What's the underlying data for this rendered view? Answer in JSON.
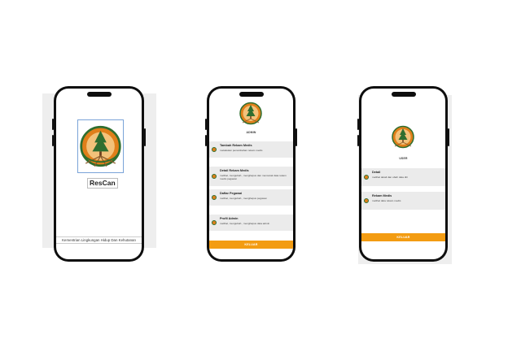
{
  "screens": {
    "splash": {
      "app_name": "ResCan",
      "footer": "Kementrian Lingkungan Hidup Dan Kehutanan",
      "logo_icon": "klhk-logo-icon"
    },
    "admin": {
      "role_title": "ADMIN",
      "menu": [
        {
          "title": "Tambah Rekam Medis",
          "desc": "melakukan penambahan rekam medis",
          "icon": "klhk-logo-icon"
        },
        {
          "title": "Detail Rekam Medis",
          "desc": "melihat, mengubah , menghapus dan mencetak data rekam medis pegawai",
          "icon": "klhk-logo-icon"
        },
        {
          "title": "Daftar Pegawai",
          "desc": "melihat, mengubah , menghapus pegawai",
          "icon": "klhk-logo-icon"
        },
        {
          "title": "Profil Admin",
          "desc": "melihat, mengubah , menghapus data admin",
          "icon": "klhk-logo-icon"
        }
      ],
      "logout_label": "KELUAR"
    },
    "user": {
      "role_title": "USER",
      "menu": [
        {
          "title": "Detail",
          "desc": "melihat detail dan ubah data diri",
          "icon": "klhk-logo-icon"
        },
        {
          "title": "Rekam Medis",
          "desc": "melihat data rekam medis",
          "icon": "klhk-logo-icon"
        }
      ],
      "logout_label": "KELUAR"
    }
  },
  "colors": {
    "accent": "#f39c12",
    "menu_bg": "#ebebeb",
    "phone_frame": "#0e0e0e",
    "logo_orange": "#e07f1a",
    "logo_green": "#2f6e2f"
  }
}
